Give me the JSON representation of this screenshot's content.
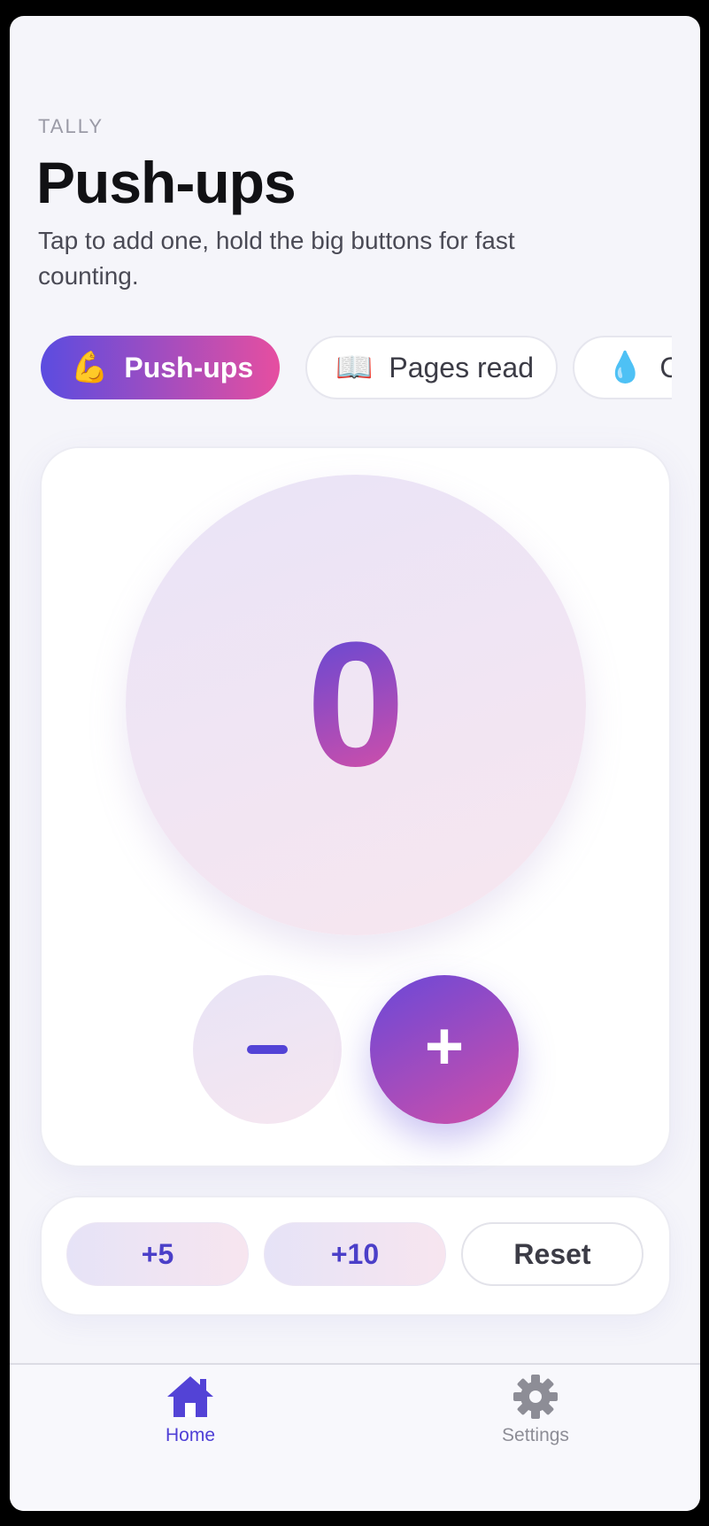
{
  "header": {
    "eyebrow": "TALLY",
    "title": "Push-ups",
    "subtitle": "Tap to add one, hold the big buttons for fast counting."
  },
  "chips": [
    {
      "emoji": "💪",
      "label": "Push-ups",
      "active": true
    },
    {
      "emoji": "📖",
      "label": "Pages read",
      "active": false
    },
    {
      "emoji": "💧",
      "label": "Cups",
      "active": false
    }
  ],
  "counter": {
    "value": "0",
    "decrement_label": "−",
    "increment_label": "+"
  },
  "quick_actions": {
    "plus5": "+5",
    "plus10": "+10",
    "reset": "Reset"
  },
  "tabbar": {
    "home": {
      "label": "Home",
      "icon": "home-icon"
    },
    "settings": {
      "label": "Settings",
      "icon": "gear-icon"
    }
  },
  "colors": {
    "accent": "#5343d6",
    "gradient_start": "#5b4ce0",
    "gradient_end": "#e64ea0"
  }
}
